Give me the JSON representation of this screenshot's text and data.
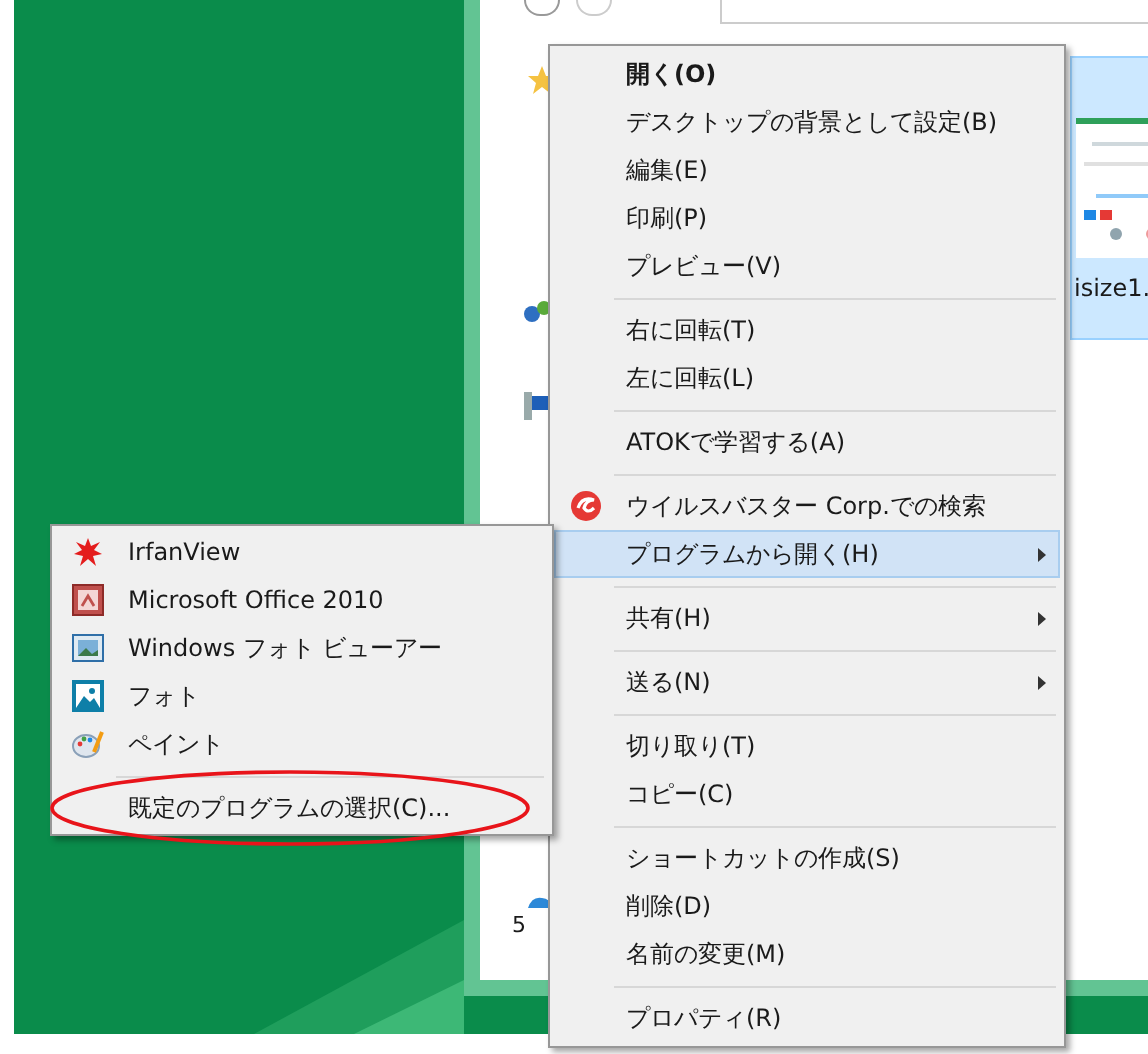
{
  "explorer": {
    "selected_file": {
      "name": "isize1.",
      "selected": true
    },
    "status": "5"
  },
  "context_menu": {
    "items": [
      {
        "kind": "item",
        "label": "開く(O)",
        "bold": true,
        "selected": false,
        "submenu": false
      },
      {
        "kind": "item",
        "label": "デスクトップの背景として設定(B)",
        "bold": false,
        "selected": false,
        "submenu": false
      },
      {
        "kind": "item",
        "label": "編集(E)",
        "bold": false,
        "selected": false,
        "submenu": false
      },
      {
        "kind": "item",
        "label": "印刷(P)",
        "bold": false,
        "selected": false,
        "submenu": false
      },
      {
        "kind": "item",
        "label": "プレビュー(V)",
        "bold": false,
        "selected": false,
        "submenu": false
      },
      {
        "kind": "separator"
      },
      {
        "kind": "item",
        "label": "右に回転(T)",
        "bold": false,
        "selected": false,
        "submenu": false
      },
      {
        "kind": "item",
        "label": "左に回転(L)",
        "bold": false,
        "selected": false,
        "submenu": false
      },
      {
        "kind": "separator"
      },
      {
        "kind": "item",
        "label": "ATOKで学習する(A)",
        "bold": false,
        "selected": false,
        "submenu": false
      },
      {
        "kind": "separator"
      },
      {
        "kind": "item",
        "label": "ウイルスバスター Corp.での検索",
        "bold": false,
        "selected": false,
        "submenu": false
      },
      {
        "kind": "item",
        "label": "プログラムから開く(H)",
        "bold": false,
        "selected": true,
        "submenu": true
      },
      {
        "kind": "separator"
      },
      {
        "kind": "item",
        "label": "共有(H)",
        "bold": false,
        "selected": false,
        "submenu": true
      },
      {
        "kind": "separator"
      },
      {
        "kind": "item",
        "label": "送る(N)",
        "bold": false,
        "selected": false,
        "submenu": true
      },
      {
        "kind": "separator"
      },
      {
        "kind": "item",
        "label": "切り取り(T)",
        "bold": false,
        "selected": false,
        "submenu": false
      },
      {
        "kind": "item",
        "label": "コピー(C)",
        "bold": false,
        "selected": false,
        "submenu": false
      },
      {
        "kind": "separator"
      },
      {
        "kind": "item",
        "label": "ショートカットの作成(S)",
        "bold": false,
        "selected": false,
        "submenu": false
      },
      {
        "kind": "item",
        "label": "削除(D)",
        "bold": false,
        "selected": false,
        "submenu": false
      },
      {
        "kind": "item",
        "label": "名前の変更(M)",
        "bold": false,
        "selected": false,
        "submenu": false
      },
      {
        "kind": "separator"
      },
      {
        "kind": "item",
        "label": "プロパティ(R)",
        "bold": false,
        "selected": false,
        "submenu": false
      }
    ]
  },
  "open_with_menu": {
    "items": [
      {
        "kind": "item",
        "label": "IrfanView",
        "circled": false
      },
      {
        "kind": "item",
        "label": "Microsoft Office 2010",
        "circled": false
      },
      {
        "kind": "item",
        "label": "Windows フォト ビューアー",
        "circled": false
      },
      {
        "kind": "item",
        "label": "フォト",
        "circled": false
      },
      {
        "kind": "item",
        "label": "ペイント",
        "circled": false
      },
      {
        "kind": "separator"
      },
      {
        "kind": "item",
        "label": "既定のプログラムの選択(C)...",
        "circled": true
      }
    ]
  }
}
